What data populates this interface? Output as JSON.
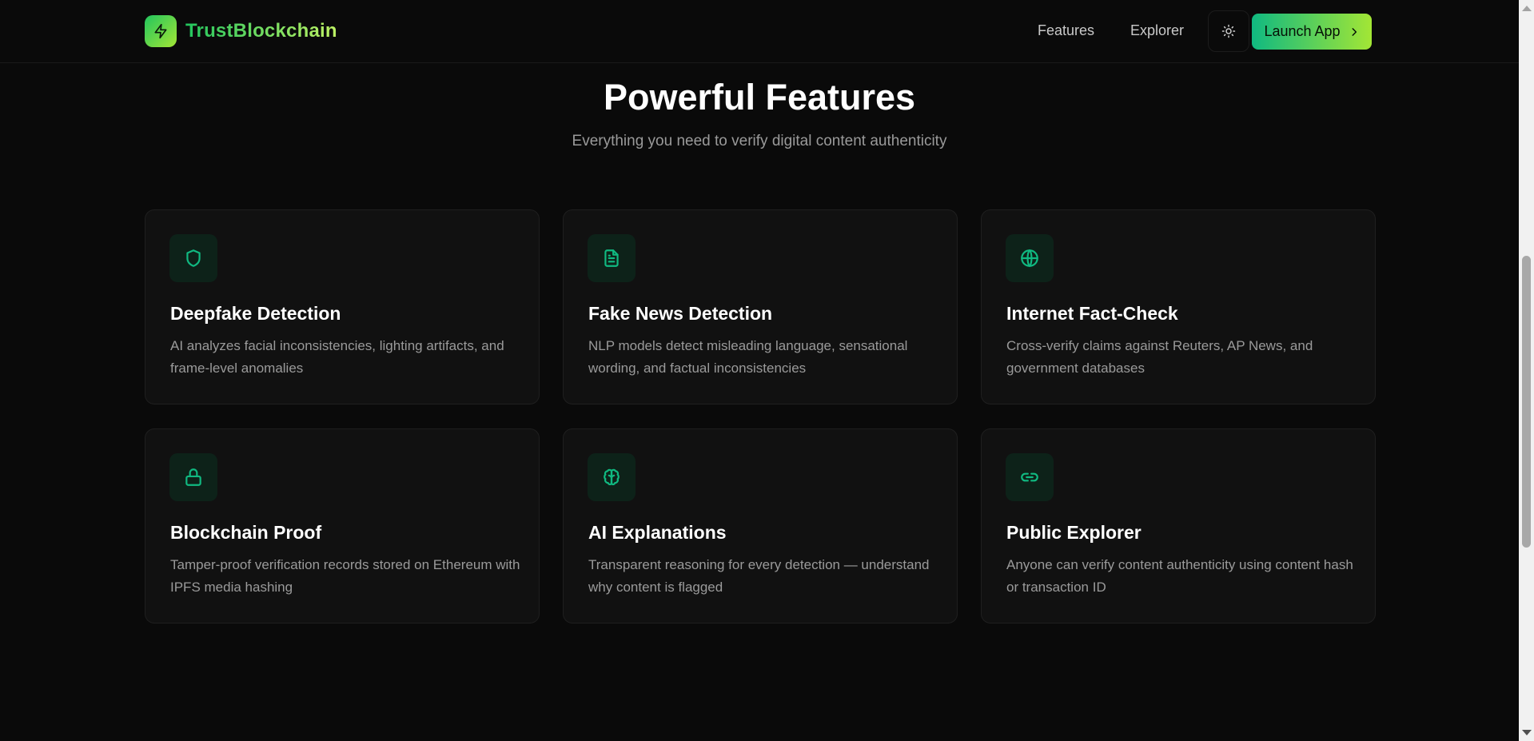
{
  "header": {
    "brand": "TrustBlockchain",
    "brand_icon": "lightning-icon",
    "nav": {
      "features": "Features",
      "explorer": "Explorer"
    },
    "theme_icon": "sun-icon",
    "launch_label": "Launch App",
    "launch_icon": "chevron-right-icon"
  },
  "section": {
    "title": "Powerful Features",
    "subtitle": "Everything you need to verify digital content authenticity"
  },
  "features": [
    {
      "icon": "shield-icon",
      "title": "Deepfake Detection",
      "description": "AI analyzes facial inconsistencies, lighting artifacts, and frame-level anomalies"
    },
    {
      "icon": "document-icon",
      "title": "Fake News Detection",
      "description": "NLP models detect misleading language, sensational wording, and factual inconsistencies"
    },
    {
      "icon": "globe-icon",
      "title": "Internet Fact-Check",
      "description": "Cross-verify claims against Reuters, AP News, and government databases"
    },
    {
      "icon": "lock-icon",
      "title": "Blockchain Proof",
      "description": "Tamper-proof verification records stored on Ethereum with IPFS media hashing"
    },
    {
      "icon": "brain-icon",
      "title": "AI Explanations",
      "description": "Transparent reasoning for every detection — understand why content is flagged"
    },
    {
      "icon": "link-icon",
      "title": "Public Explorer",
      "description": "Anyone can verify content authenticity using content hash or transaction ID"
    }
  ],
  "colors": {
    "background": "#0a0a0a",
    "card": "#111111",
    "accent_green": "#10b981",
    "accent_lime": "#a3e635"
  }
}
